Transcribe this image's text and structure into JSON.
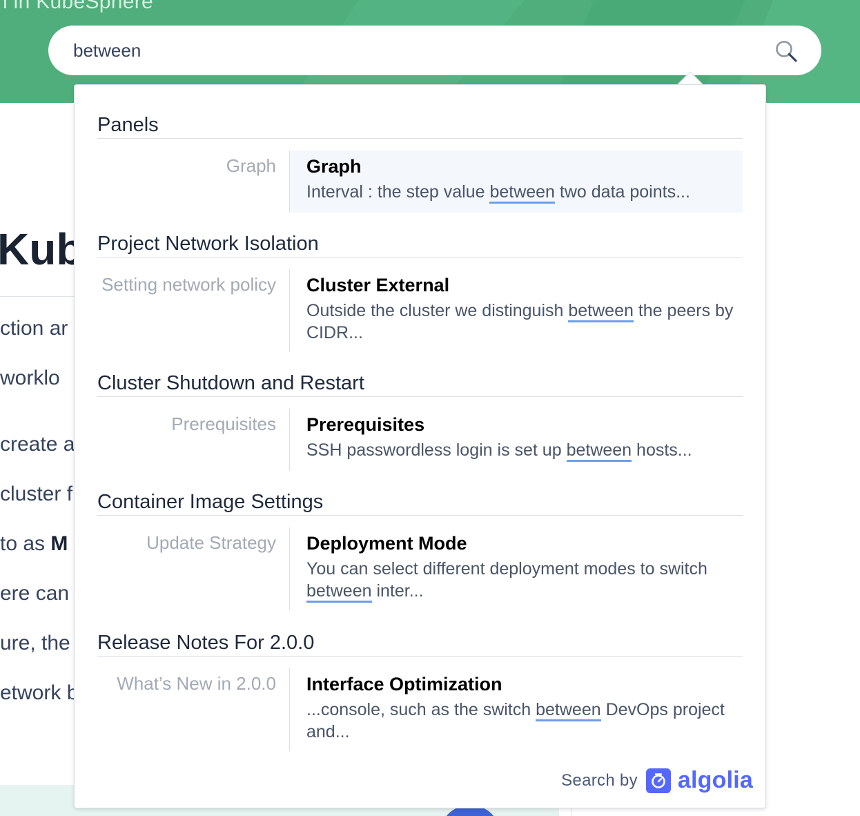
{
  "header": {
    "title_fragment": "n in KubeSphere",
    "colors": {
      "band": "#4fae7c"
    }
  },
  "search": {
    "value": "between",
    "icon": "search-icon"
  },
  "background_article": {
    "heading_fragment": "Kub",
    "lines": [
      "ction ar",
      " worklo",
      "create a",
      "cluster f",
      "to as ",
      "ere can",
      "ure, the",
      "etwork b"
    ],
    "bold_fragment": "M"
  },
  "results": {
    "highlight_color": "#6c9ee8",
    "sections": [
      {
        "title": "Panels",
        "hit": {
          "subcategory": "Graph",
          "title": "Graph",
          "text_before": "Interval : the step value ",
          "match": "between",
          "text_after": " two data points..."
        }
      },
      {
        "title": "Project Network Isolation",
        "hit": {
          "subcategory": "Setting network policy",
          "title": "Cluster External",
          "text_before": "Outside the cluster we distinguish ",
          "match": "between",
          "text_after": " the peers by CIDR..."
        }
      },
      {
        "title": "Cluster Shutdown and Restart",
        "hit": {
          "subcategory": "Prerequisites",
          "title": "Prerequisites",
          "text_before": "SSH passwordless login is set up ",
          "match": "between",
          "text_after": " hosts..."
        }
      },
      {
        "title": "Container Image Settings",
        "hit": {
          "subcategory": "Update Strategy",
          "title": "Deployment Mode",
          "text_before": "You can select different deployment modes to switch ",
          "match": "between",
          "text_after": " inter..."
        }
      },
      {
        "title": "Release Notes For 2.0.0",
        "hit": {
          "subcategory": "What’s New in 2.0.0",
          "title": "Interface Optimization",
          "text_before": "...console, such as the switch ",
          "match": "between",
          "text_after": " DevOps project and..."
        }
      }
    ]
  },
  "footer": {
    "label": "Search by",
    "brand": "algolia",
    "brand_color": "#5468ff"
  }
}
